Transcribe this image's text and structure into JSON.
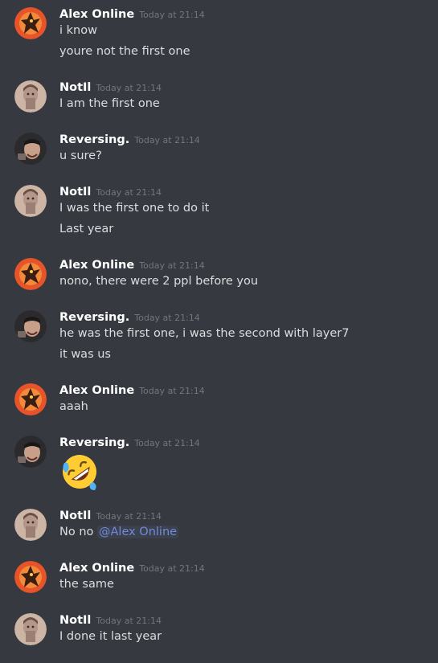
{
  "colors": {
    "background": "#36393f",
    "username": "#ffffff",
    "timestamp": "#72767d",
    "text": "#dcddde",
    "mention": "#7289da"
  },
  "messages": [
    {
      "author": "Alex Online",
      "time": "Today at 21:14",
      "lines": [
        "i know",
        "youre not the first one"
      ]
    },
    {
      "author": "NotIl",
      "time": "Today at 21:14",
      "lines": [
        "I am the first one"
      ]
    },
    {
      "author": "Reversing.",
      "time": "Today at 21:14",
      "lines": [
        "u sure?"
      ]
    },
    {
      "author": "NotIl",
      "time": "Today at 21:14",
      "lines": [
        "I was the first one to do it",
        "Last year"
      ]
    },
    {
      "author": "Alex Online",
      "time": "Today at 21:14",
      "lines": [
        "nono, there were 2 ppl before you"
      ]
    },
    {
      "author": "Reversing.",
      "time": "Today at 21:14",
      "lines": [
        "he was the first one, i was the second with layer7",
        "it was us"
      ]
    },
    {
      "author": "Alex Online",
      "time": "Today at 21:14",
      "lines": [
        "aaah"
      ]
    },
    {
      "author": "Reversing.",
      "time": "Today at 21:14",
      "emoji": "rolling-on-floor-laughing-emoji"
    },
    {
      "author": "NotIl",
      "time": "Today at 21:14",
      "prefix": "No no ",
      "mention": "@Alex Online"
    },
    {
      "author": "Alex Online",
      "time": "Today at 21:14",
      "lines": [
        "the same"
      ]
    },
    {
      "author": "NotIl",
      "time": "Today at 21:14",
      "lines": [
        "I done it last year"
      ]
    }
  ]
}
